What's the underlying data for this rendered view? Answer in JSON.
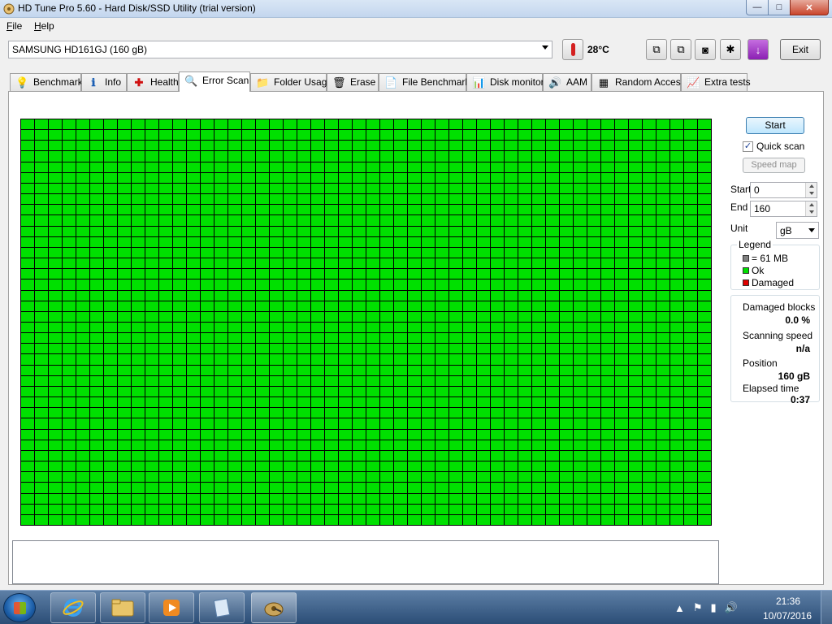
{
  "window": {
    "title": "HD Tune Pro 5.60 - Hard Disk/SSD Utility (trial version)",
    "buttons": {
      "minimize": "—",
      "maximize": "□",
      "close": "✕"
    }
  },
  "menu": [
    "File",
    "Help"
  ],
  "toolbar": {
    "drive": "SAMSUNG HD161GJ (160 gB)",
    "temperature": "28°C",
    "exit_label": "Exit",
    "icons": [
      "copy-icon",
      "copy-all-icon",
      "camera-icon",
      "chip-icon",
      "save-icon"
    ]
  },
  "tabs": [
    {
      "label": "Benchmark",
      "icon": "benchmark-icon",
      "glyph": "💡"
    },
    {
      "label": "Info",
      "icon": "info-icon",
      "glyph": "ℹ"
    },
    {
      "label": "Health",
      "icon": "health-icon",
      "glyph": "✚"
    },
    {
      "label": "Error Scan",
      "icon": "error-scan-icon",
      "glyph": "🔍",
      "active": true
    },
    {
      "label": "Folder Usage",
      "icon": "folder-icon",
      "glyph": "📁"
    },
    {
      "label": "Erase",
      "icon": "erase-icon",
      "glyph": "🗑"
    },
    {
      "label": "File Benchmark",
      "icon": "file-benchmark-icon",
      "glyph": "📄"
    },
    {
      "label": "Disk monitor",
      "icon": "disk-monitor-icon",
      "glyph": "📊"
    },
    {
      "label": "AAM",
      "icon": "speaker-icon",
      "glyph": "🔊"
    },
    {
      "label": "Random Access",
      "icon": "random-access-icon",
      "glyph": "▦"
    },
    {
      "label": "Extra tests",
      "icon": "extra-tests-icon",
      "glyph": "📈"
    }
  ],
  "scan": {
    "grid_columns": 50,
    "grid_rows": 38,
    "block_state": "ok",
    "ok_color": "#00e000"
  },
  "controls": {
    "start_label": "Start",
    "quick_scan_label": "Quick scan",
    "quick_scan_checked": true,
    "speed_map_label": "Speed map",
    "start_field_label": "Start",
    "start_value": "0",
    "end_field_label": "End",
    "end_value": "160",
    "unit_label": "Unit",
    "unit_value": "gB"
  },
  "legend": {
    "title": "Legend",
    "items": [
      {
        "label": "= 61 MB",
        "color": "#808080"
      },
      {
        "label": "Ok",
        "color": "#00e000"
      },
      {
        "label": "Damaged",
        "color": "#e00000"
      }
    ]
  },
  "stats": {
    "damaged_blocks_label": "Damaged blocks",
    "damaged_blocks_value": "0.0 %",
    "scanning_speed_label": "Scanning speed",
    "scanning_speed_value": "n/a",
    "position_label": "Position",
    "position_value": "160 gB",
    "elapsed_label": "Elapsed time",
    "elapsed_value": "0:37"
  },
  "taskbar": {
    "apps": [
      "internet-explorer-icon",
      "explorer-icon",
      "media-player-icon",
      "notepad-icon",
      "hd-tune-icon"
    ],
    "tray_icons": [
      "show-hidden-icon",
      "flag-icon",
      "network-icon",
      "volume-icon"
    ],
    "time": "21:36",
    "date": "10/07/2016"
  }
}
